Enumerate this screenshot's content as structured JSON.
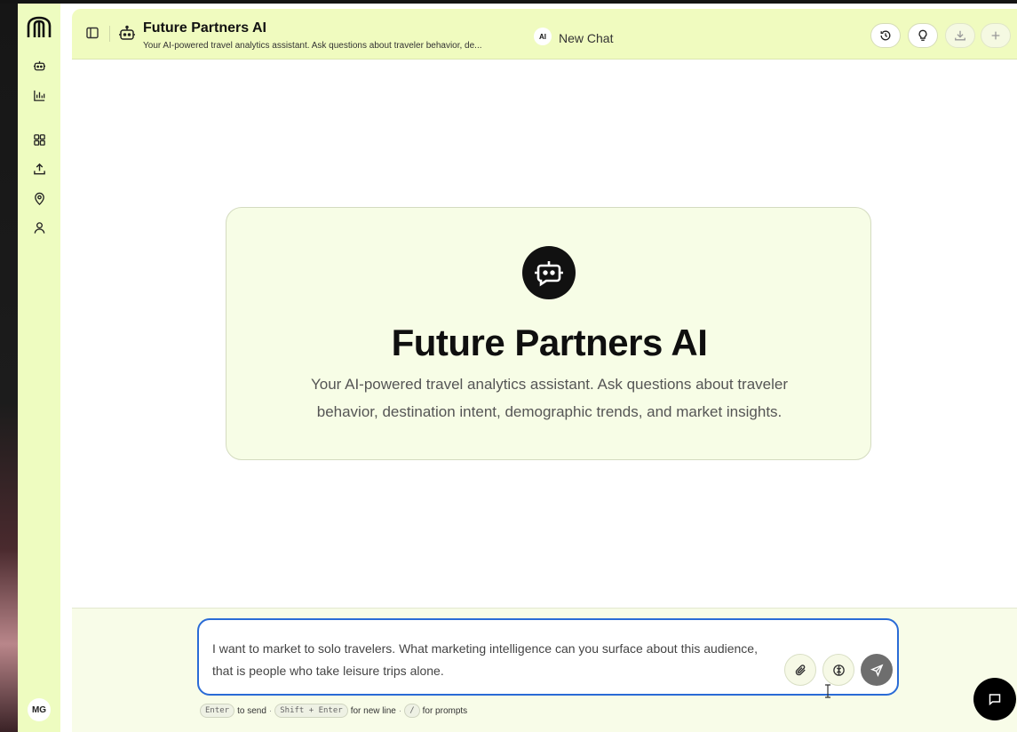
{
  "app": {
    "title": "Future Partners AI",
    "subtitle": "Your AI-powered travel analytics assistant. Ask questions about traveler behavior, de...",
    "chat_badge": "AI",
    "chat_name": "New Chat"
  },
  "sidebar": {
    "items": [
      {
        "icon": "bot-icon"
      },
      {
        "icon": "chart-icon"
      },
      {
        "icon": "grid-icon"
      },
      {
        "icon": "upload-icon"
      },
      {
        "icon": "location-icon"
      },
      {
        "icon": "user-icon"
      }
    ],
    "avatar_initials": "MG"
  },
  "header_actions": [
    {
      "icon": "history-icon"
    },
    {
      "icon": "lightbulb-icon"
    },
    {
      "icon": "download-icon"
    },
    {
      "icon": "plus-icon"
    }
  ],
  "welcome": {
    "title": "Future Partners AI",
    "description": "Your AI-powered travel analytics assistant. Ask questions about traveler behavior, destination intent, demographic trends, and market insights."
  },
  "composer": {
    "value": "I want to market to solo travelers. What marketing intelligence can you surface about this audience, that is people who take leisure trips alone.",
    "hints": {
      "enter_key": "Enter",
      "enter_text": "to send",
      "shift_key": "Shift + Enter",
      "shift_text": "for new line",
      "slash_key": "/",
      "slash_text": "for prompts"
    }
  },
  "colors": {
    "accent": "#eefcc0",
    "focus_border": "#2a6bd6",
    "send_button": "#6e6e6e"
  }
}
